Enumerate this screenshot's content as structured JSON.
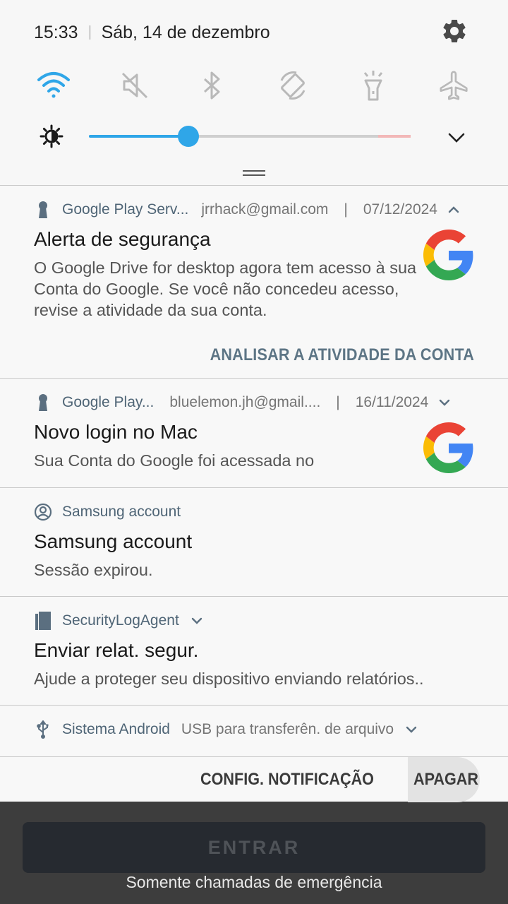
{
  "status": {
    "time": "15:33",
    "date": "Sáb, 14 de dezembro"
  },
  "quick_settings": {
    "tiles": [
      {
        "name": "wifi",
        "icon": "wifi-icon",
        "active": true
      },
      {
        "name": "sound",
        "icon": "mute-icon",
        "active": false
      },
      {
        "name": "bluetooth",
        "icon": "bluetooth-icon",
        "active": false
      },
      {
        "name": "auto-rotate",
        "icon": "rotate-icon",
        "active": false
      },
      {
        "name": "flashlight",
        "icon": "flashlight-icon",
        "active": false
      },
      {
        "name": "airplane-mode",
        "icon": "airplane-icon",
        "active": false
      }
    ],
    "brightness_level": 0.31
  },
  "notifications": [
    {
      "app": "Google Play Serv...",
      "account": "jrrhack@gmail.com",
      "date": "07/12/2024",
      "title": "Alerta de segurança",
      "body": "O Google Drive for desktop agora tem acesso à sua Conta do Google. Se você não concedeu acesso, revise a atividade da sua conta.",
      "action": "ANALISAR A ATIVIDADE DA CONTA"
    },
    {
      "app": "Google Play...",
      "account": "bluelemon.jh@gmail....",
      "date": "16/11/2024",
      "title": "Novo login no Mac",
      "body": "Sua Conta do Google foi acessada no"
    },
    {
      "app": "Samsung account",
      "title": "Samsung account",
      "body": "Sessão expirou."
    },
    {
      "app": "SecurityLogAgent",
      "title": "Enviar relat. segur.",
      "body": "Ajude a proteger seu dispositivo enviando relatórios.."
    },
    {
      "app": "Sistema Android",
      "text": "USB para transferên. de arquivo"
    }
  ],
  "footer": {
    "settings_label": "CONFIG. NOTIFICAÇÃO",
    "clear_label": "APAGAR"
  },
  "lockscreen": {
    "enter_label": "ENTRAR",
    "emergency_text": "Somente chamadas de emergência"
  },
  "colors": {
    "accent": "#2fa6e8",
    "header_text": "#5b6f80",
    "action_text": "#5d7585"
  }
}
